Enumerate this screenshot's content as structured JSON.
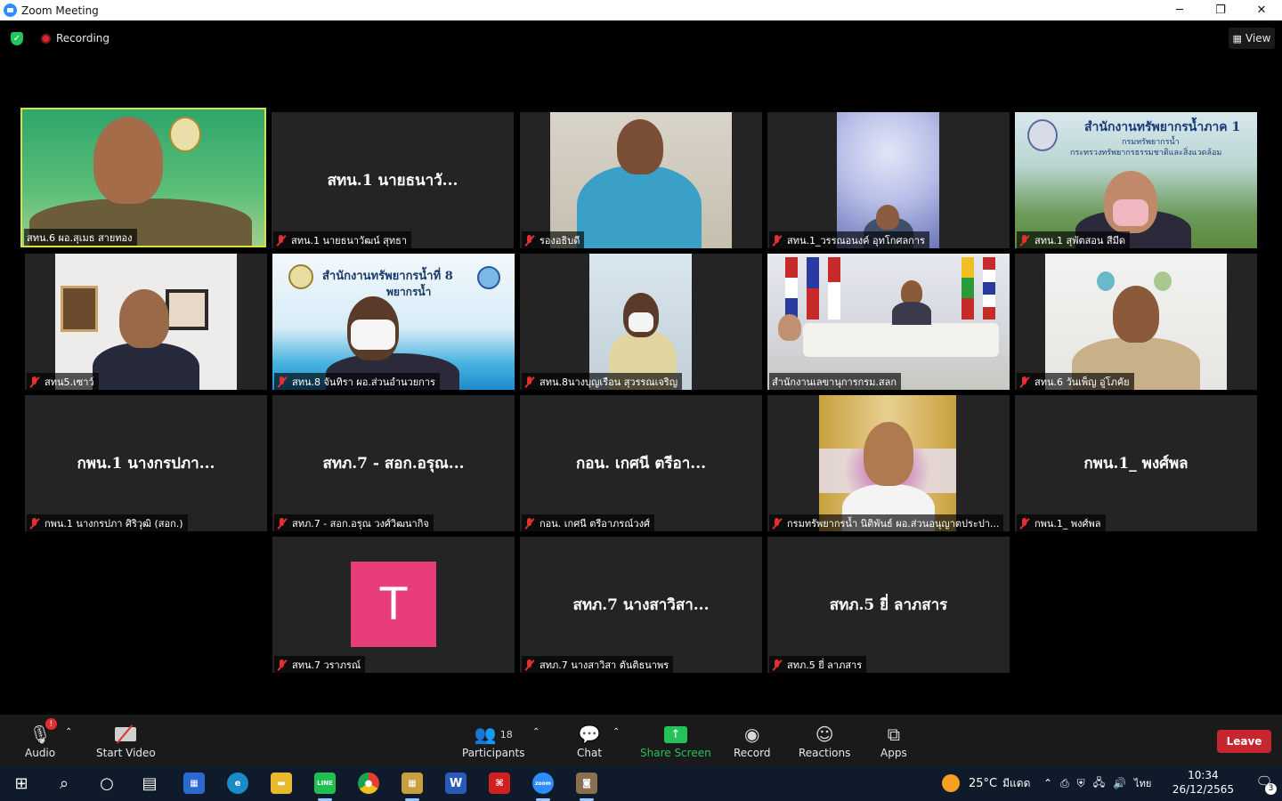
{
  "window": {
    "title": "Zoom Meeting",
    "minimize": "─",
    "maximize": "❐",
    "close": "✕"
  },
  "topbar": {
    "recording": "Recording",
    "view": "View"
  },
  "tiles": [
    {
      "label": "สทน.6 ผอ.สุเมธ สายทอง",
      "muted": false
    },
    {
      "display": "สทน.1 นายธนาวั...",
      "label": "สทน.1 นายธนาวัฒน์ สุทธา"
    },
    {
      "label": "รองอธิบดี"
    },
    {
      "label": "สทน.1_วรรณอนงค์ อุทโกศลการ"
    },
    {
      "label": "สทน.1 สุพัตสอน สีมีด"
    },
    {
      "label": "สทน5.เซาว์"
    },
    {
      "label": "สทน.8 จันทิรา  ผอ.ส่วนอำนวยการ"
    },
    {
      "label": "สทน.8นางบุญเรือน สุวรรณเจริญ"
    },
    {
      "label": "สำนักงานเลขานุการกรม.สลก"
    },
    {
      "label": "สทน.6 วันเพ็ญ  อู่โภคัย"
    },
    {
      "display": "กพน.1 นางกรปภา...",
      "label": "กพน.1 นางกรปภา ศิริวุฒิ (สอก.)"
    },
    {
      "display": "สทภ.7 - สอก.อรุณ...",
      "label": "สทภ.7 - สอก.อรุณ วงศ์วิฒนากิจ"
    },
    {
      "display": "กอน. เกศนี ตรีอา...",
      "label": "กอน. เกศนี ตรีอาภรณ์วงศ์"
    },
    {
      "label": "กรมทรัพยากรน้ำ นิติพันธ์ ผอ.ส่วนอนุญาตประปา..."
    },
    {
      "display": "กพน.1_ พงศ์พล",
      "label": "กพน.1_ พงศ์พล"
    },
    {
      "avatar": "T",
      "label": "สทน.7 วราภรณ์"
    },
    {
      "display": "สทภ.7 นางสาวิสา...",
      "label": "สทภ.7 นางสาวิสา ตันติธนาพร"
    },
    {
      "display": "สทภ.5  ยี่  ลาภสาร",
      "label": "สทภ.5  ยี่  ลาภสาร"
    }
  ],
  "banners": {
    "region8": "สำนักงานทรัพยากรน้ำที่ 8",
    "region8_sub": "พยากรน้ำ",
    "region1": "สำนักงานทรัพยากรน้ำภาค 1",
    "region1_sub": "กรมทรัพยากรน้ำ",
    "region1_sub2": "กระทรวงทรัพยากรธรรมชาติและสิ่งแวดล้อม"
  },
  "toolbar": {
    "audio": "Audio",
    "start_video": "Start Video",
    "participants": "Participants",
    "participants_count": "18",
    "chat": "Chat",
    "share_screen": "Share Screen",
    "record": "Record",
    "reactions": "Reactions",
    "apps": "Apps",
    "leave": "Leave",
    "audio_badge": "!"
  },
  "taskbar": {
    "weather_temp": "25°C",
    "weather_text": "มีแดด",
    "lang": "ไทย",
    "time": "10:34",
    "date": "26/12/2565",
    "notifications": "3",
    "app_line": "LINE",
    "app_word": "W",
    "app_zoom": "zoom"
  }
}
